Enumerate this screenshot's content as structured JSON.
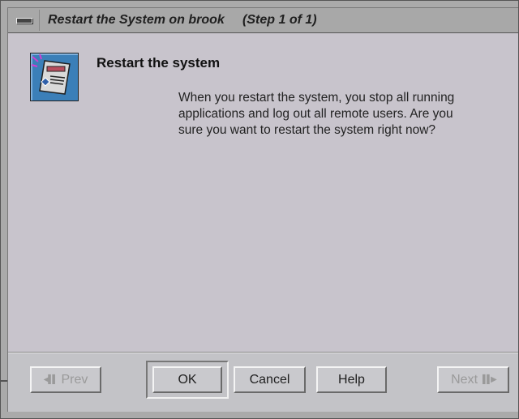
{
  "window": {
    "title": "Restart the System on brook     (Step 1 of 1)"
  },
  "dialog": {
    "heading": "Restart the system",
    "message": "When you restart the system, you stop all running applications and log out all remote users. Are you sure you want to restart the system right now?"
  },
  "buttons": {
    "prev": "Prev",
    "ok": "OK",
    "cancel": "Cancel",
    "help": "Help",
    "next": "Next"
  },
  "icons": {
    "window_menu": "window-menu-icon",
    "app": "system-restart-icon",
    "prev_arrow": "prev-arrow-icon",
    "next_arrow": "next-arrow-icon"
  },
  "colors": {
    "title_bar": "#a8a8a8",
    "dialog_background": "#c8c4cc",
    "icon_blue": "#3b7fb8",
    "disabled_text": "#9a9a9a"
  }
}
